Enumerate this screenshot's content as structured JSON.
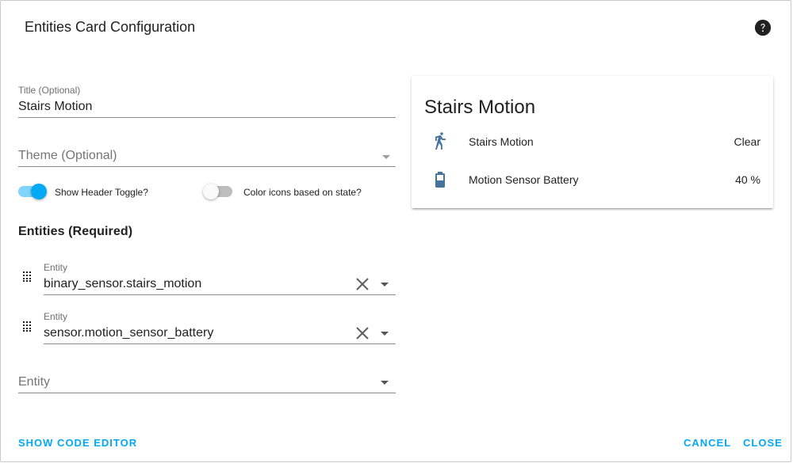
{
  "dialog": {
    "title": "Entities Card Configuration",
    "help_icon": "help-circle-icon"
  },
  "form": {
    "title_field": {
      "label": "Title (Optional)",
      "value": "Stairs Motion"
    },
    "theme_field": {
      "placeholder": "Theme (Optional)"
    },
    "toggles": [
      {
        "label": "Show Header Toggle?",
        "checked": true
      },
      {
        "label": "Color icons based on state?",
        "checked": false
      }
    ],
    "entities_section_title": "Entities (Required)",
    "entity_rows": [
      {
        "label": "Entity",
        "value": "binary_sensor.stairs_motion"
      },
      {
        "label": "Entity",
        "value": "sensor.motion_sensor_battery"
      }
    ],
    "new_entity_placeholder": "Entity"
  },
  "preview": {
    "title": "Stairs Motion",
    "rows": [
      {
        "icon": "walk-icon",
        "name": "Stairs Motion",
        "state": "Clear"
      },
      {
        "icon": "battery-icon",
        "name": "Motion Sensor Battery",
        "state": "40 %"
      }
    ]
  },
  "actions": {
    "code_editor": "Show Code Editor",
    "cancel": "Cancel",
    "close": "Close"
  },
  "colors": {
    "accent": "#03a9f4",
    "toggle_on_track": "#81d4fa",
    "icon_blue": "#44739e"
  }
}
